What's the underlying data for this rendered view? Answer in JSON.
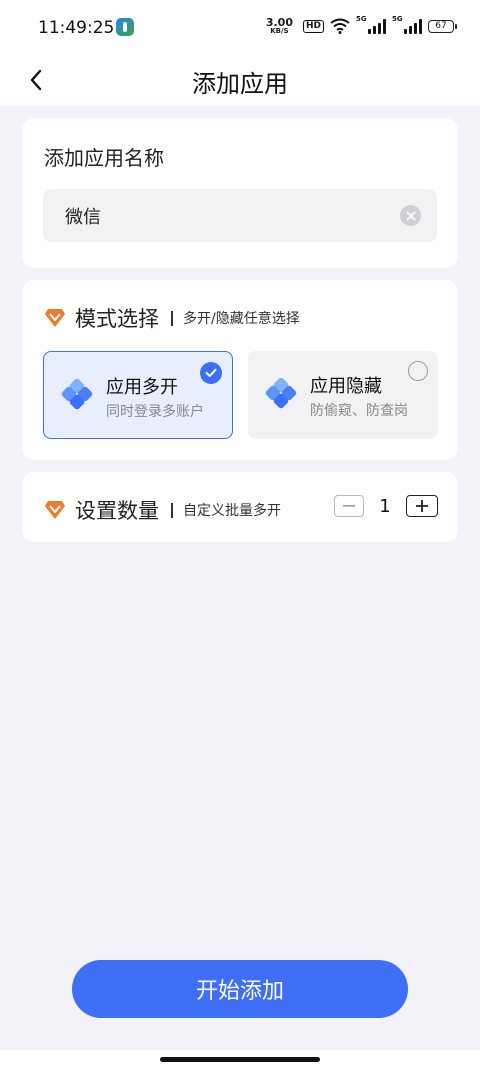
{
  "status": {
    "time": "11:49:25",
    "net_speed_value": "3.00",
    "net_speed_unit": "KB/S",
    "hd": "HD",
    "sim1": "5G",
    "sim2": "5G",
    "battery": "67"
  },
  "nav": {
    "title": "添加应用",
    "back_icon": "chevron-left-icon"
  },
  "name_card": {
    "title": "添加应用名称",
    "input_value": "微信"
  },
  "mode_card": {
    "label": "模式选择",
    "desc": "多开/隐藏任意选择",
    "options": [
      {
        "title": "应用多开",
        "sub": "同时登录多账户",
        "selected": true
      },
      {
        "title": "应用隐藏",
        "sub": "防偷窥、防查岗",
        "selected": false
      }
    ]
  },
  "qty_card": {
    "label": "设置数量",
    "desc": "自定义批量多开",
    "value": "1"
  },
  "start_button": "开始添加",
  "colors": {
    "accent": "#3f6ff7",
    "gem": "#f07a2d",
    "background": "#f3f2f8"
  }
}
